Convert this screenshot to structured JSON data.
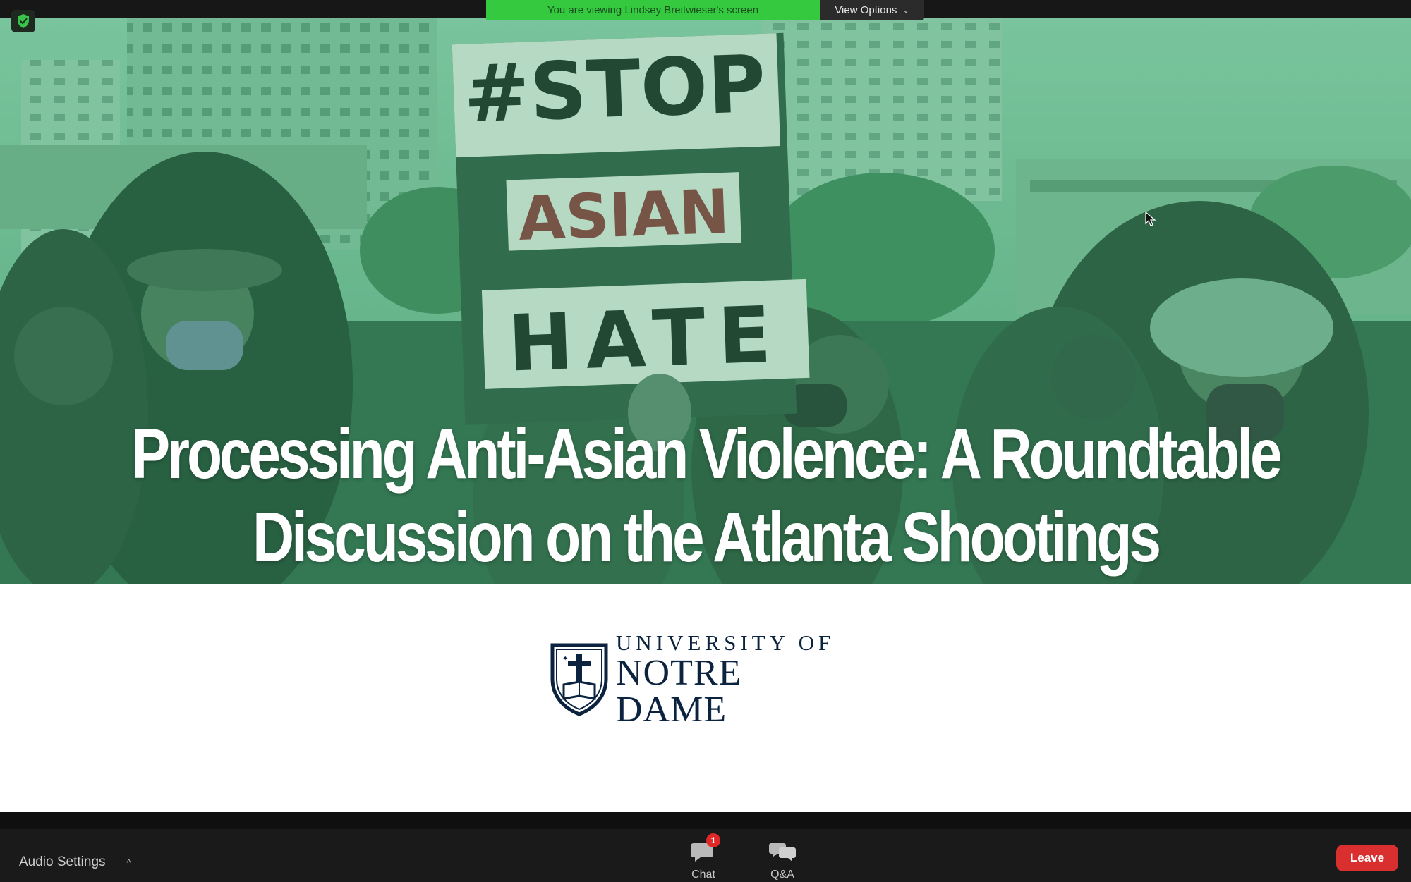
{
  "meeting": {
    "viewing_banner": "You are viewing Lindsey Breitwieser's screen",
    "view_options_label": "View Options",
    "security_icon": "shield-check-icon"
  },
  "slide": {
    "title_line1": "Processing Anti-Asian Violence: A Roundtable",
    "title_line2": "Discussion on the Atlanta Shootings",
    "sign_text": [
      "#STOP",
      "ASIAN",
      "HATE"
    ],
    "logo": {
      "line1": "UNIVERSITY OF",
      "line2": "NOTRE DAME"
    },
    "colors": {
      "overlay_green": "#3f9a68",
      "text_white": "#ffffff",
      "logo_navy": "#0c2340"
    }
  },
  "toolbar": {
    "audio_settings_label": "Audio Settings",
    "chat_label": "Chat",
    "chat_badge": "1",
    "qa_label": "Q&A",
    "leave_label": "Leave"
  },
  "colors": {
    "banner_green": "#35c93f",
    "leave_red": "#d92f2f",
    "toolbar_bg": "#1a1a1a"
  }
}
